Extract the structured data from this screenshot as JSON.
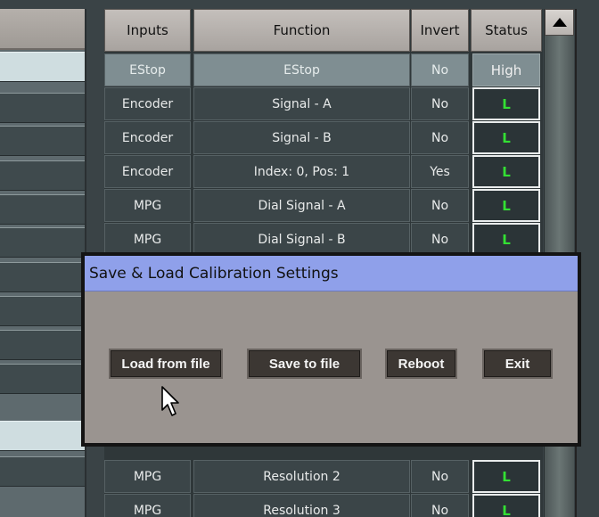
{
  "table": {
    "headers": {
      "inputs": "Inputs",
      "function": "Function",
      "invert": "Invert",
      "status": "Status"
    },
    "rows": [
      {
        "input": "EStop",
        "function": "EStop",
        "invert": "No",
        "status": "High"
      },
      {
        "input": "Encoder",
        "function": "Signal - A",
        "invert": "No",
        "status": "L"
      },
      {
        "input": "Encoder",
        "function": "Signal - B",
        "invert": "No",
        "status": "L"
      },
      {
        "input": "Encoder",
        "function": "Index: 0, Pos: 1",
        "invert": "Yes",
        "status": "L"
      },
      {
        "input": "MPG",
        "function": "Dial Signal - A",
        "invert": "No",
        "status": "L"
      },
      {
        "input": "MPG",
        "function": "Dial Signal - B",
        "invert": "No",
        "status": "L"
      },
      {
        "input": "MPG",
        "function": "Resolution 2",
        "invert": "No",
        "status": "L"
      },
      {
        "input": "MPG",
        "function": "Resolution 3",
        "invert": "No",
        "status": "L"
      }
    ]
  },
  "dialog": {
    "title": "Save & Load Calibration Settings",
    "buttons": {
      "load": "Load from file",
      "save": "Save to file",
      "reboot": "Reboot",
      "exit": "Exit"
    }
  },
  "colors": {
    "status_low": "#33e033",
    "dialog_title_bg": "#8fa0ea",
    "button_bg": "#3c3733",
    "estop_row_bg": "#7f8e92"
  },
  "icons": {
    "scroll_up": "triangle-up-icon",
    "pointer": "mouse-pointer-icon"
  }
}
